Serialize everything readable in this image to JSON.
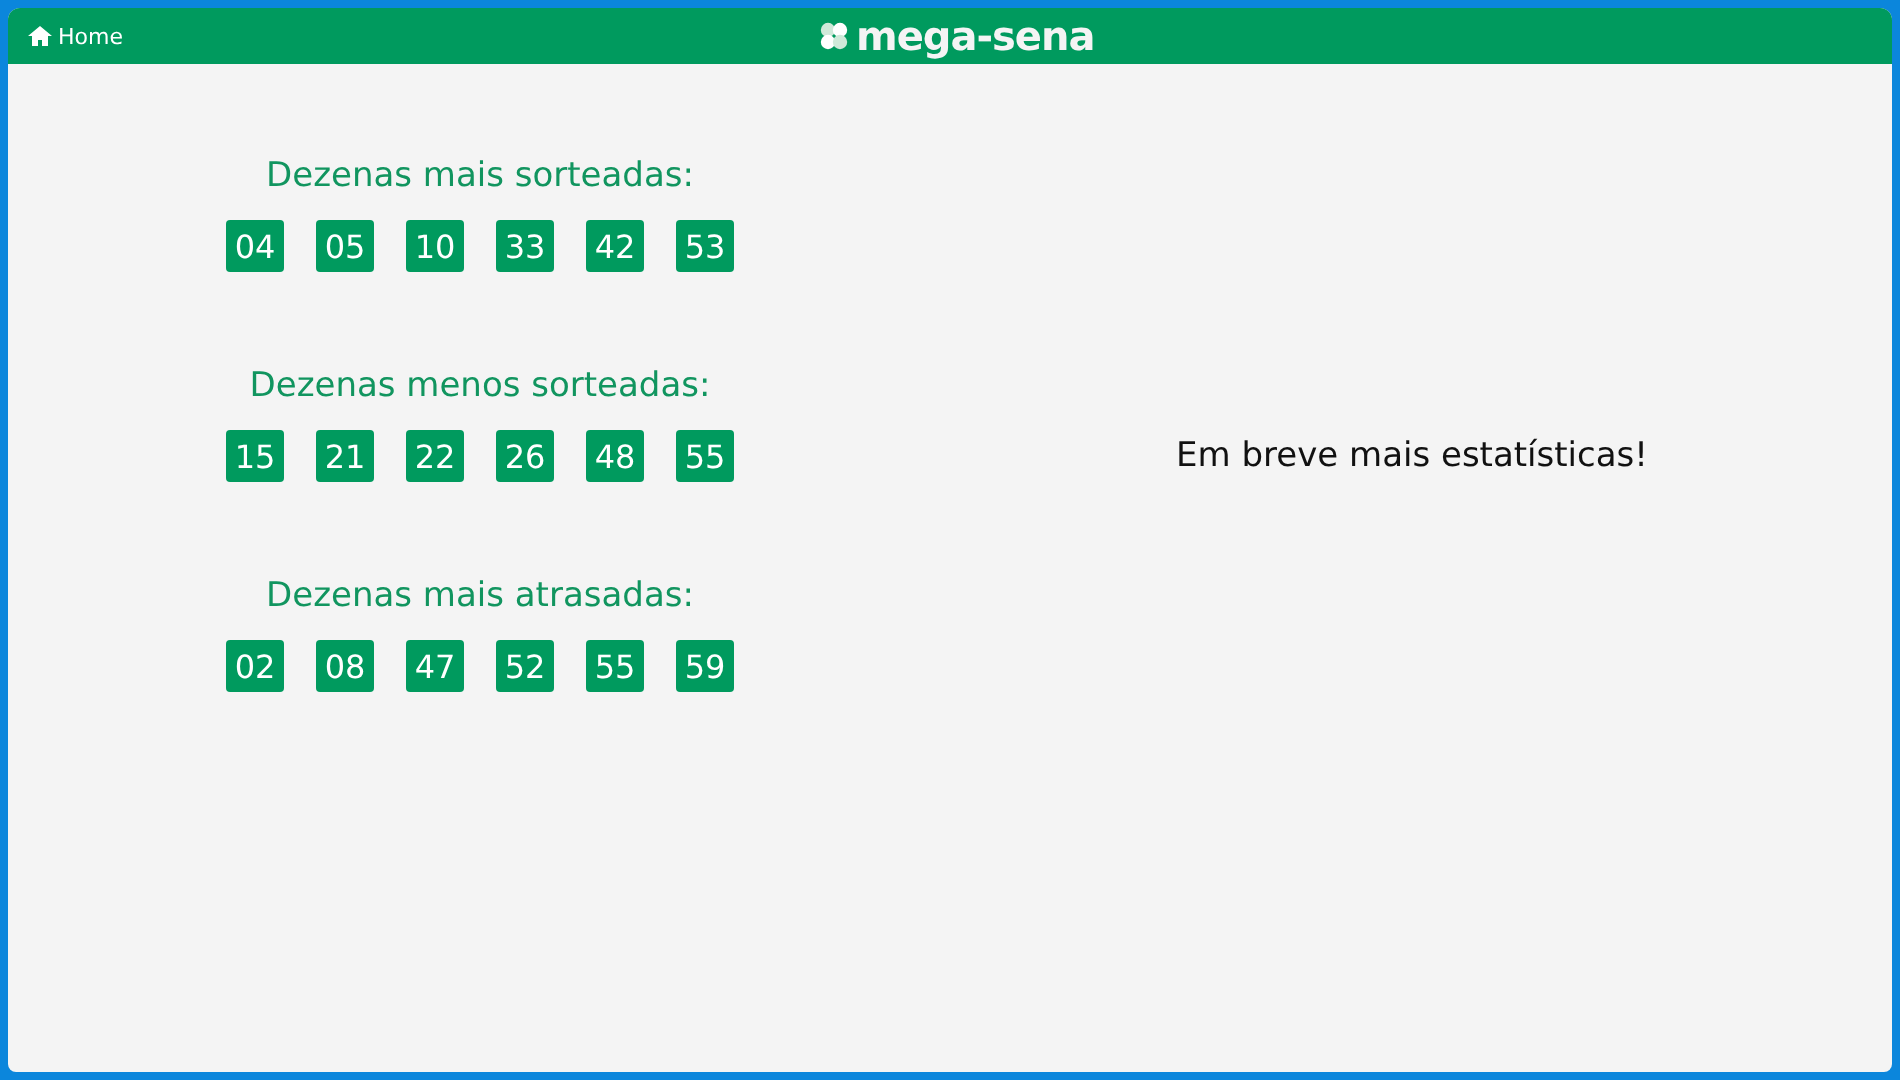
{
  "header": {
    "home_link": "Home",
    "logo": "mega-sena"
  },
  "sections": [
    {
      "title": "Dezenas mais sorteadas:",
      "numbers": [
        "04",
        "05",
        "10",
        "33",
        "42",
        "53"
      ]
    },
    {
      "title": "Dezenas menos sorteadas:",
      "numbers": [
        "15",
        "21",
        "22",
        "26",
        "48",
        "55"
      ]
    },
    {
      "title": "Dezenas mais atrasadas:",
      "numbers": [
        "02",
        "08",
        "47",
        "52",
        "55",
        "59"
      ]
    }
  ],
  "notice": "Em breve mais estatísticas!"
}
